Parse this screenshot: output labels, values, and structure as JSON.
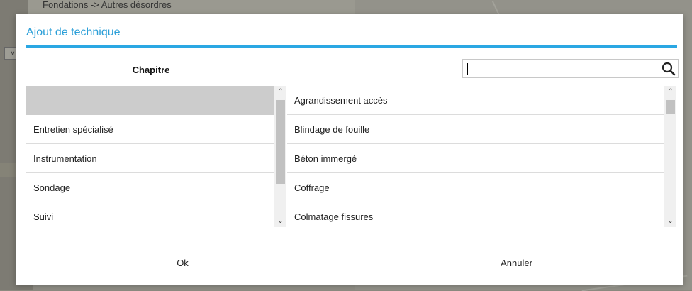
{
  "background": {
    "breadcrumb": "Fondations -> Autres désordres"
  },
  "dialog": {
    "title": "Ajout de technique",
    "accent_color": "#2aa7e3",
    "left_column_header": "Chapitre",
    "search": {
      "value": "",
      "placeholder": "",
      "icon": "search-icon"
    },
    "chapitres": [
      "",
      "Entretien spécialisé",
      "Instrumentation",
      "Sondage",
      "Suivi"
    ],
    "selected_chapitre_index": 0,
    "techniques": [
      "Agrandissement accès",
      "Blindage de fouille",
      "Béton immergé",
      "Coffrage",
      "Colmatage fissures"
    ],
    "ok_label": "Ok",
    "cancel_label": "Annuler"
  }
}
